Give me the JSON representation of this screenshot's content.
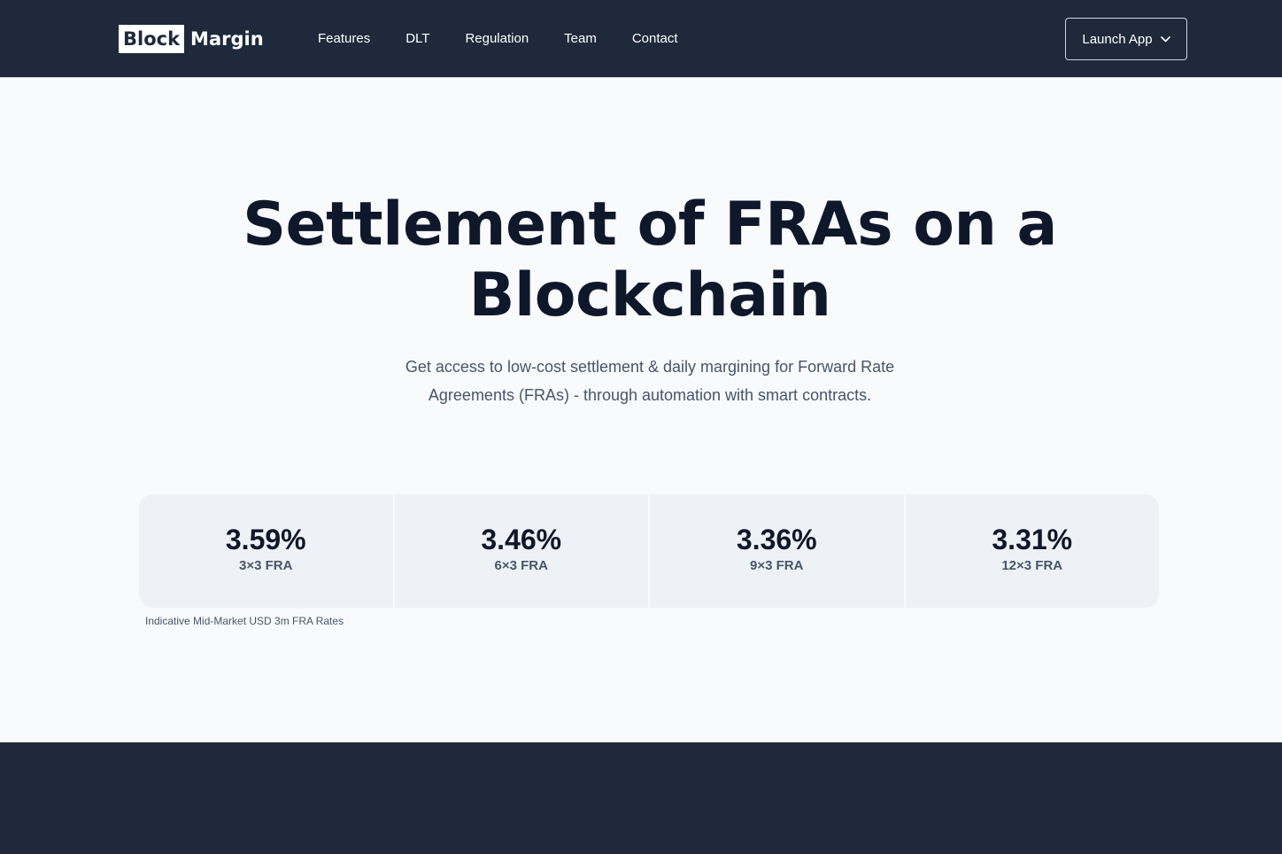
{
  "brand": {
    "block": "Block",
    "margin": "Margin"
  },
  "nav": {
    "items": [
      {
        "label": "Features"
      },
      {
        "label": "DLT"
      },
      {
        "label": "Regulation"
      },
      {
        "label": "Team"
      },
      {
        "label": "Contact"
      }
    ],
    "launch_label": "Launch App"
  },
  "hero": {
    "title_line1": "Settlement of FRAs on a",
    "title_line2": "Blockchain",
    "subtitle_line1": "Get access to low-cost settlement & daily margining for Forward Rate",
    "subtitle_line2": "Agreements (FRAs) - through automation with smart contracts."
  },
  "rates": {
    "items": [
      {
        "value": "3.59%",
        "label": "3×3 FRA"
      },
      {
        "value": "3.46%",
        "label": "6×3 FRA"
      },
      {
        "value": "3.36%",
        "label": "9×3 FRA"
      },
      {
        "value": "3.31%",
        "label": "12×3 FRA"
      }
    ],
    "caption": "Indicative Mid-Market USD 3m FRA Rates"
  },
  "colors": {
    "navbar_bg": "#1e293b",
    "page_bg": "#f8fafc",
    "card_bg": "#eef2f6",
    "text_dark": "#0f172a",
    "text_muted": "#475569"
  },
  "icons": {
    "launch_dropdown": "chevron-down-icon"
  }
}
